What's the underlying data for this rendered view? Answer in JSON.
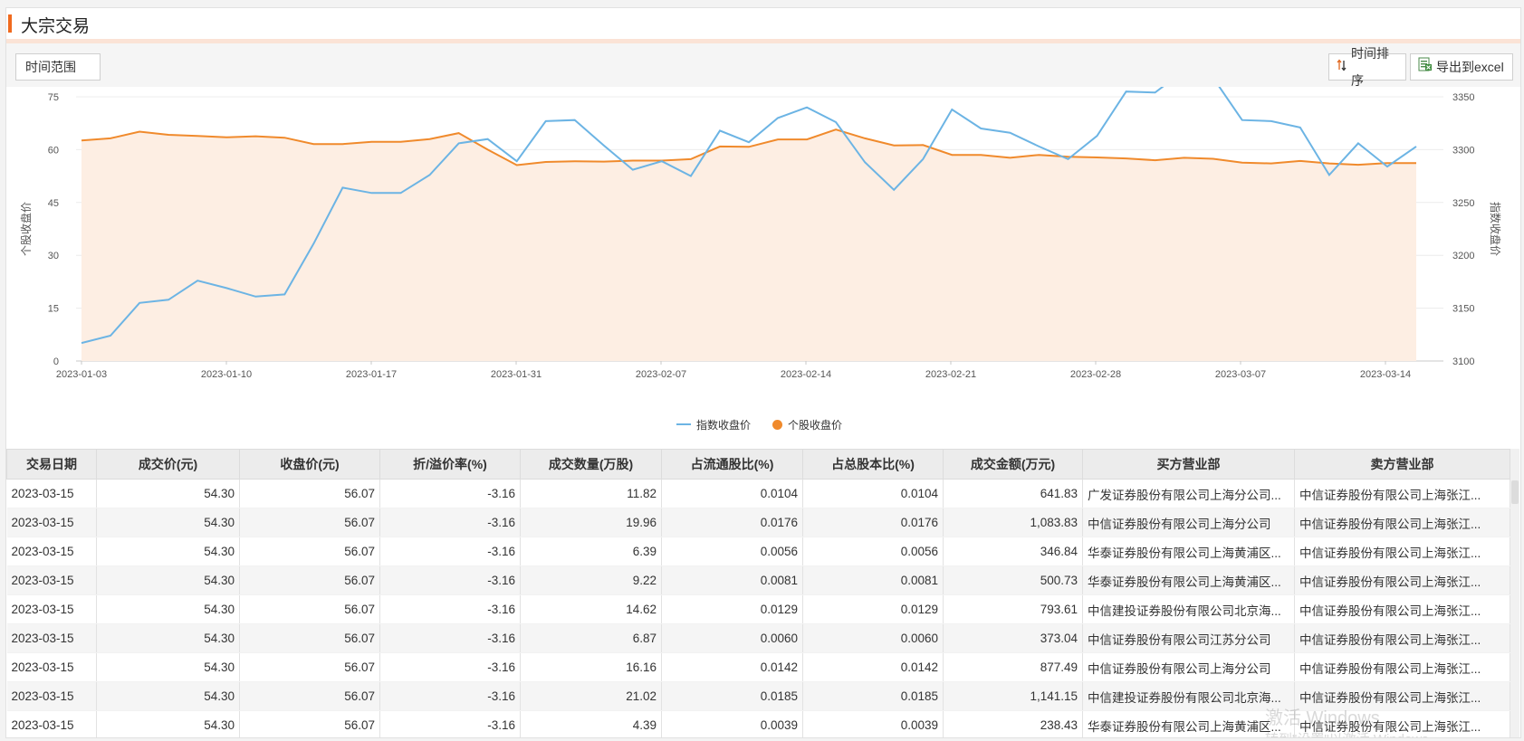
{
  "page": {
    "title": "大宗交易"
  },
  "toolbar": {
    "time_range_label": "时间范围",
    "sort_label": "时间排序",
    "sort_icon": "sort-arrows-icon",
    "export_label": "导出到excel",
    "export_icon": "excel-icon"
  },
  "colors": {
    "accent": "#f06a1e",
    "index_line": "#6cb4e4",
    "stock_line": "#f08a2c",
    "stock_fill": "#fdeee3"
  },
  "chart_data": {
    "type": "line",
    "y_left": {
      "label": "个股收盘价",
      "min": 0,
      "max": 75,
      "ticks": [
        "0",
        "15",
        "30",
        "45",
        "60",
        "75"
      ]
    },
    "y_right": {
      "label": "指数收盘价",
      "min": 3100,
      "max": 3350,
      "ticks": [
        "3100",
        "3150",
        "3200",
        "3250",
        "3300",
        "3350"
      ]
    },
    "x_ticks": [
      "2023-01-03",
      "2023-01-10",
      "2023-01-17",
      "2023-01-31",
      "2023-02-07",
      "2023-02-14",
      "2023-02-21",
      "2023-02-28",
      "2023-03-07",
      "2023-03-14"
    ],
    "grid": true,
    "legend_position": "bottom-center",
    "series": [
      {
        "name": "指数收盘价",
        "axis": "right",
        "values": [
          3117,
          3124,
          3155,
          3158,
          3176,
          3169,
          3161,
          3163,
          3211,
          3264,
          3259,
          3259,
          3276,
          3306,
          3310,
          3289,
          3327,
          3328,
          3304,
          3281,
          3289,
          3275,
          3318,
          3307,
          3330,
          3340,
          3326,
          3288,
          3262,
          3291,
          3338,
          3320,
          3316,
          3303,
          3291,
          3313,
          3355,
          3354,
          3375,
          3368,
          3328,
          3327,
          3321,
          3276,
          3306,
          3284,
          3303
        ]
      },
      {
        "name": "个股收盘价",
        "axis": "left",
        "values": [
          62.6,
          63.2,
          65.1,
          64.2,
          63.9,
          63.5,
          63.8,
          63.4,
          61.6,
          61.6,
          62.2,
          62.2,
          63.0,
          64.7,
          60.0,
          55.6,
          56.5,
          56.7,
          56.6,
          56.9,
          56.9,
          57.3,
          60.9,
          60.8,
          62.9,
          62.9,
          65.7,
          63.2,
          61.2,
          61.3,
          58.5,
          58.5,
          57.7,
          58.5,
          58.0,
          57.8,
          57.5,
          57.0,
          57.7,
          57.4,
          56.3,
          56.1,
          56.8,
          56.1,
          55.7,
          56.2,
          56.2
        ]
      }
    ]
  },
  "table": {
    "columns": [
      "交易日期",
      "成交价(元)",
      "收盘价(元)",
      "折/溢价率(%)",
      "成交数量(万股)",
      "占流通股比(%)",
      "占总股本比(%)",
      "成交金额(万元)",
      "买方营业部",
      "卖方营业部"
    ],
    "rows": [
      [
        "2023-03-15",
        "54.30",
        "56.07",
        "-3.16",
        "11.82",
        "0.0104",
        "0.0104",
        "641.83",
        "广发证券股份有限公司上海分公司...",
        "中信证券股份有限公司上海张江..."
      ],
      [
        "2023-03-15",
        "54.30",
        "56.07",
        "-3.16",
        "19.96",
        "0.0176",
        "0.0176",
        "1,083.83",
        "中信证券股份有限公司上海分公司",
        "中信证券股份有限公司上海张江..."
      ],
      [
        "2023-03-15",
        "54.30",
        "56.07",
        "-3.16",
        "6.39",
        "0.0056",
        "0.0056",
        "346.84",
        "华泰证券股份有限公司上海黄浦区...",
        "中信证券股份有限公司上海张江..."
      ],
      [
        "2023-03-15",
        "54.30",
        "56.07",
        "-3.16",
        "9.22",
        "0.0081",
        "0.0081",
        "500.73",
        "华泰证券股份有限公司上海黄浦区...",
        "中信证券股份有限公司上海张江..."
      ],
      [
        "2023-03-15",
        "54.30",
        "56.07",
        "-3.16",
        "14.62",
        "0.0129",
        "0.0129",
        "793.61",
        "中信建投证券股份有限公司北京海...",
        "中信证券股份有限公司上海张江..."
      ],
      [
        "2023-03-15",
        "54.30",
        "56.07",
        "-3.16",
        "6.87",
        "0.0060",
        "0.0060",
        "373.04",
        "中信证券股份有限公司江苏分公司",
        "中信证券股份有限公司上海张江..."
      ],
      [
        "2023-03-15",
        "54.30",
        "56.07",
        "-3.16",
        "16.16",
        "0.0142",
        "0.0142",
        "877.49",
        "中信证券股份有限公司上海分公司",
        "中信证券股份有限公司上海张江..."
      ],
      [
        "2023-03-15",
        "54.30",
        "56.07",
        "-3.16",
        "21.02",
        "0.0185",
        "0.0185",
        "1,141.15",
        "中信建投证券股份有限公司北京海...",
        "中信证券股份有限公司上海张江..."
      ],
      [
        "2023-03-15",
        "54.30",
        "56.07",
        "-3.16",
        "4.39",
        "0.0039",
        "0.0039",
        "238.43",
        "华泰证券股份有限公司上海黄浦区...",
        "中信证券股份有限公司上海张江..."
      ]
    ]
  },
  "watermark": {
    "line1": "激活 Windows",
    "line2": "转到\"设置\"以激活 Windows。"
  }
}
